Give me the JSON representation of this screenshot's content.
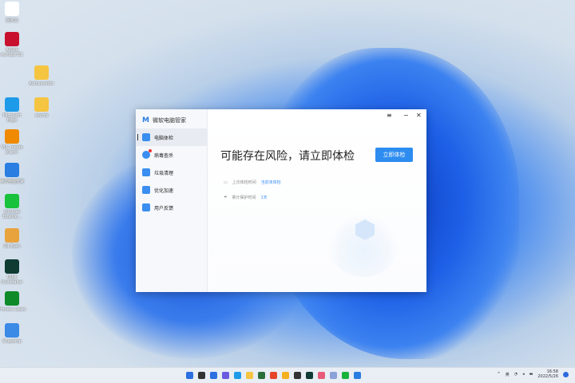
{
  "desktop": {
    "icons": [
      {
        "label": "回收站",
        "color": "#ffffff"
      },
      {
        "label": "Adobe Acrobat DC",
        "color": "#c8102e"
      },
      {
        "label": "Autosaveder",
        "color": "#f5c542"
      },
      {
        "label": "Microsoft Edge",
        "color": "#1e9be8"
      },
      {
        "label": "source",
        "color": "#f5c542"
      },
      {
        "label": "VLC media player",
        "color": "#f08a00"
      },
      {
        "label": "腾讯电脑管家",
        "color": "#2a7de1"
      },
      {
        "label": "Internet Downlo...",
        "color": "#19c23c"
      },
      {
        "label": "Git Bash",
        "color": "#e8a33d"
      },
      {
        "label": "IObit Uninstaller",
        "color": "#0f3b33"
      },
      {
        "label": "Process Lasso",
        "color": "#0e8a28"
      },
      {
        "label": "Snapdrop",
        "color": "#3b8ae6"
      }
    ]
  },
  "app": {
    "title": "微软电脑管家",
    "controls": {
      "menu": "≡",
      "minimize": "−",
      "close": "✕"
    },
    "nav": [
      {
        "label": "电脑体检",
        "icon": "monitor-icon",
        "active": true
      },
      {
        "label": "病毒查杀",
        "icon": "shield-icon",
        "badge": true
      },
      {
        "label": "垃圾清理",
        "icon": "broom-icon"
      },
      {
        "label": "优化加速",
        "icon": "rocket-icon"
      },
      {
        "label": "用户反馈",
        "icon": "feedback-icon"
      }
    ],
    "headline": "可能存在风险，请立即体检",
    "scan_button": "立即体检",
    "last_check_label": "上次体检时间",
    "last_check_value": "当前未体检",
    "protect_label": "累计保护时间",
    "protect_value": "1天"
  },
  "taskbar": {
    "tray": {
      "chevron": "^",
      "ime": "英",
      "time": "16:58",
      "date": "2022/5/26"
    }
  }
}
